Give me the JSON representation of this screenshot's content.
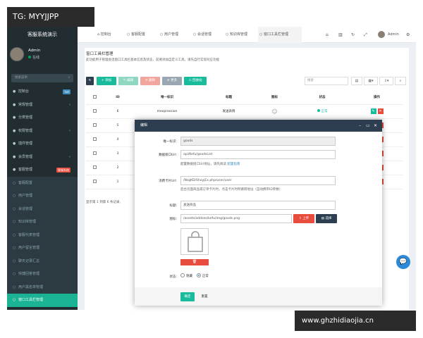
{
  "watermarks": {
    "top": "TG: MYYJJPP",
    "bottom": "www.ghzhidiaojia.cn"
  },
  "colors": {
    "sidebar": "#222d32",
    "active": "#1ab394",
    "primary": "#3c8dbc",
    "danger": "#e74c3c",
    "success": "#18bc9c",
    "modal_header": "#2c3e50"
  },
  "sidebar": {
    "title": "客服系统演示",
    "user": {
      "name": "Admin",
      "status": "在线"
    },
    "search_placeholder": "搜索菜单",
    "items": [
      {
        "label": "控制台",
        "icon": "dashboard-icon",
        "badge": "hot",
        "badge_color": "#3c8dbc"
      },
      {
        "label": "常规管理",
        "icon": "gear-icon",
        "arrow": "‹"
      },
      {
        "label": "分类管理",
        "icon": "list-icon"
      },
      {
        "label": "权限管理",
        "icon": "users-icon",
        "arrow": "‹"
      },
      {
        "label": "插件管理",
        "icon": "plug-icon"
      },
      {
        "label": "会员管理",
        "icon": "member-icon",
        "arrow": "‹"
      },
      {
        "label": "客服管理",
        "icon": "comments-icon",
        "badge": "客服系统",
        "badge_color": "#e74c3c"
      }
    ],
    "subitems": [
      {
        "label": "客服配置"
      },
      {
        "label": "用户管理"
      },
      {
        "label": "会话管理"
      },
      {
        "label": "知识库管理"
      },
      {
        "label": "客服代表管理"
      },
      {
        "label": "用户留言管理"
      },
      {
        "label": "聊天记录汇总"
      },
      {
        "label": "快捷回答管理"
      },
      {
        "label": "用户黑名单管理"
      },
      {
        "label": "窗口工具栏管理",
        "active": true
      }
    ]
  },
  "topbar": {
    "tabs": [
      "控制台",
      "客服配置",
      "用户管理",
      "会话管理",
      "知识库管理",
      "窗口工具栏管理"
    ],
    "admin": "Admin"
  },
  "panel": {
    "title": "窗口工具栏管理",
    "desc": "此功能用于管理会话窗口工具栏基本信息及状态，前要添加自定义工具，请先自行实现对应功能",
    "toolbar": [
      "添加",
      "编辑",
      "删除",
      "更多",
      "回收站"
    ],
    "search_placeholder": "搜索",
    "columns": [
      "ID",
      "唯一标识",
      "标题",
      "图标",
      "状态",
      "操作"
    ],
    "rows": [
      {
        "id": "6",
        "key": "mexpression",
        "title": "发送表情",
        "status": "正常"
      },
      {
        "id": "5"
      },
      {
        "id": "4"
      },
      {
        "id": "3"
      },
      {
        "id": "2"
      },
      {
        "id": "1"
      }
    ],
    "footer": "显示第 1 到第 6 条记录,"
  },
  "modal": {
    "title": "编辑",
    "fields": {
      "key_label": "唯一标识:",
      "key_value": "goods",
      "api_label": "数据接口Url:",
      "api_value": "api/Kefu/goodsList",
      "api_hint": "配置数据接口Url地址，请先阅读",
      "api_hint_link": "配置指南",
      "card_label": "消费卡片Url:",
      "card_value": "/NsgKD/ShoyjEx.php/user/user",
      "card_hint": "后台页面商品或订单卡片时，点击卡片时所跳转地址（自动携带ID参数）",
      "title_label": "标题:",
      "title_value": "发送商品",
      "icon_label": "图标:",
      "icon_value": "/assets/addons/kefu/img/goods.png",
      "upload": "上传",
      "choose": "选择",
      "status_label": "状态:",
      "status_hidden": "隐藏",
      "status_normal": "正常"
    },
    "ok": "确定",
    "reset": "重置"
  }
}
